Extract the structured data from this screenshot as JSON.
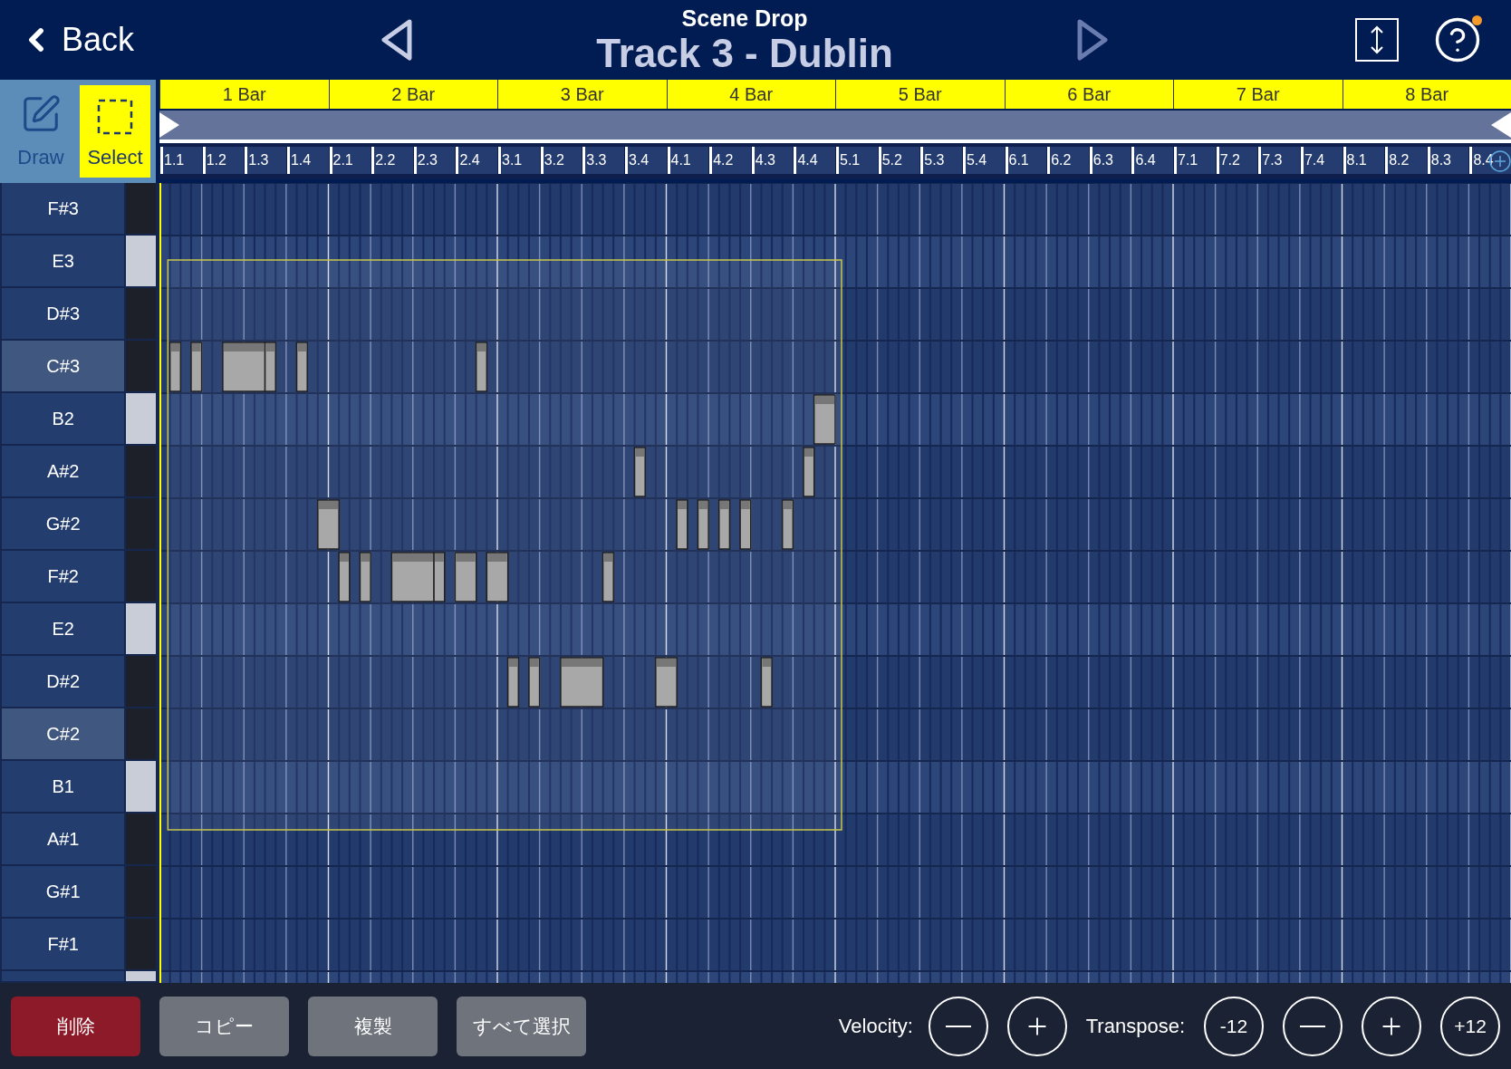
{
  "header": {
    "back_label": "Back",
    "scene": "Scene Drop",
    "track": "Track 3 - Dublin",
    "prev": {
      "disabled": false
    },
    "next": {
      "disabled": true
    },
    "help": {
      "notification": true
    }
  },
  "tools": [
    {
      "label": "Draw",
      "kind": "draw",
      "selected": false
    },
    {
      "label": "Select",
      "kind": "select",
      "selected": true
    }
  ],
  "bars": [
    "1 Bar",
    "2 Bar",
    "3 Bar",
    "4 Bar",
    "5 Bar",
    "6 Bar",
    "7 Bar",
    "8 Bar"
  ],
  "beats": [
    "1.1",
    "1.2",
    "1.3",
    "1.4",
    "2.1",
    "2.2",
    "2.3",
    "2.4",
    "3.1",
    "3.2",
    "3.3",
    "3.4",
    "4.1",
    "4.2",
    "4.3",
    "4.4",
    "5.1",
    "5.2",
    "5.3",
    "5.4",
    "6.1",
    "6.2",
    "6.3",
    "6.4",
    "7.1",
    "7.2",
    "7.3",
    "7.4",
    "8.1",
    "8.2",
    "8.3",
    "8.4"
  ],
  "keys": [
    {
      "label": "F#3",
      "kind": "black",
      "highlighted": false
    },
    {
      "label": "E3",
      "kind": "white",
      "highlighted": false
    },
    {
      "label": "D#3",
      "kind": "black",
      "highlighted": false
    },
    {
      "label": "C#3",
      "kind": "black",
      "highlighted": true
    },
    {
      "label": "B2",
      "kind": "white",
      "highlighted": false
    },
    {
      "label": "A#2",
      "kind": "black",
      "highlighted": false
    },
    {
      "label": "G#2",
      "kind": "black",
      "highlighted": false
    },
    {
      "label": "F#2",
      "kind": "black",
      "highlighted": false
    },
    {
      "label": "E2",
      "kind": "white",
      "highlighted": false
    },
    {
      "label": "D#2",
      "kind": "black",
      "highlighted": false
    },
    {
      "label": "C#2",
      "kind": "black",
      "highlighted": true
    },
    {
      "label": "B1",
      "kind": "white",
      "highlighted": false
    },
    {
      "label": "A#1",
      "kind": "black",
      "highlighted": false
    },
    {
      "label": "G#1",
      "kind": "black",
      "highlighted": false
    },
    {
      "label": "F#1",
      "kind": "black",
      "highlighted": false
    },
    {
      "kind": "white",
      "highlighted": false
    }
  ],
  "actions": [
    {
      "label": "削除",
      "kind": "danger"
    },
    {
      "label": "コピー",
      "kind": "normal"
    },
    {
      "label": "複製",
      "kind": "normal"
    },
    {
      "label": "すべて選択",
      "kind": "normal"
    }
  ],
  "velocity": {
    "label": "Velocity:"
  },
  "transpose": {
    "label": "Transpose:",
    "down_octave": "-12",
    "up_octave": "+12"
  }
}
